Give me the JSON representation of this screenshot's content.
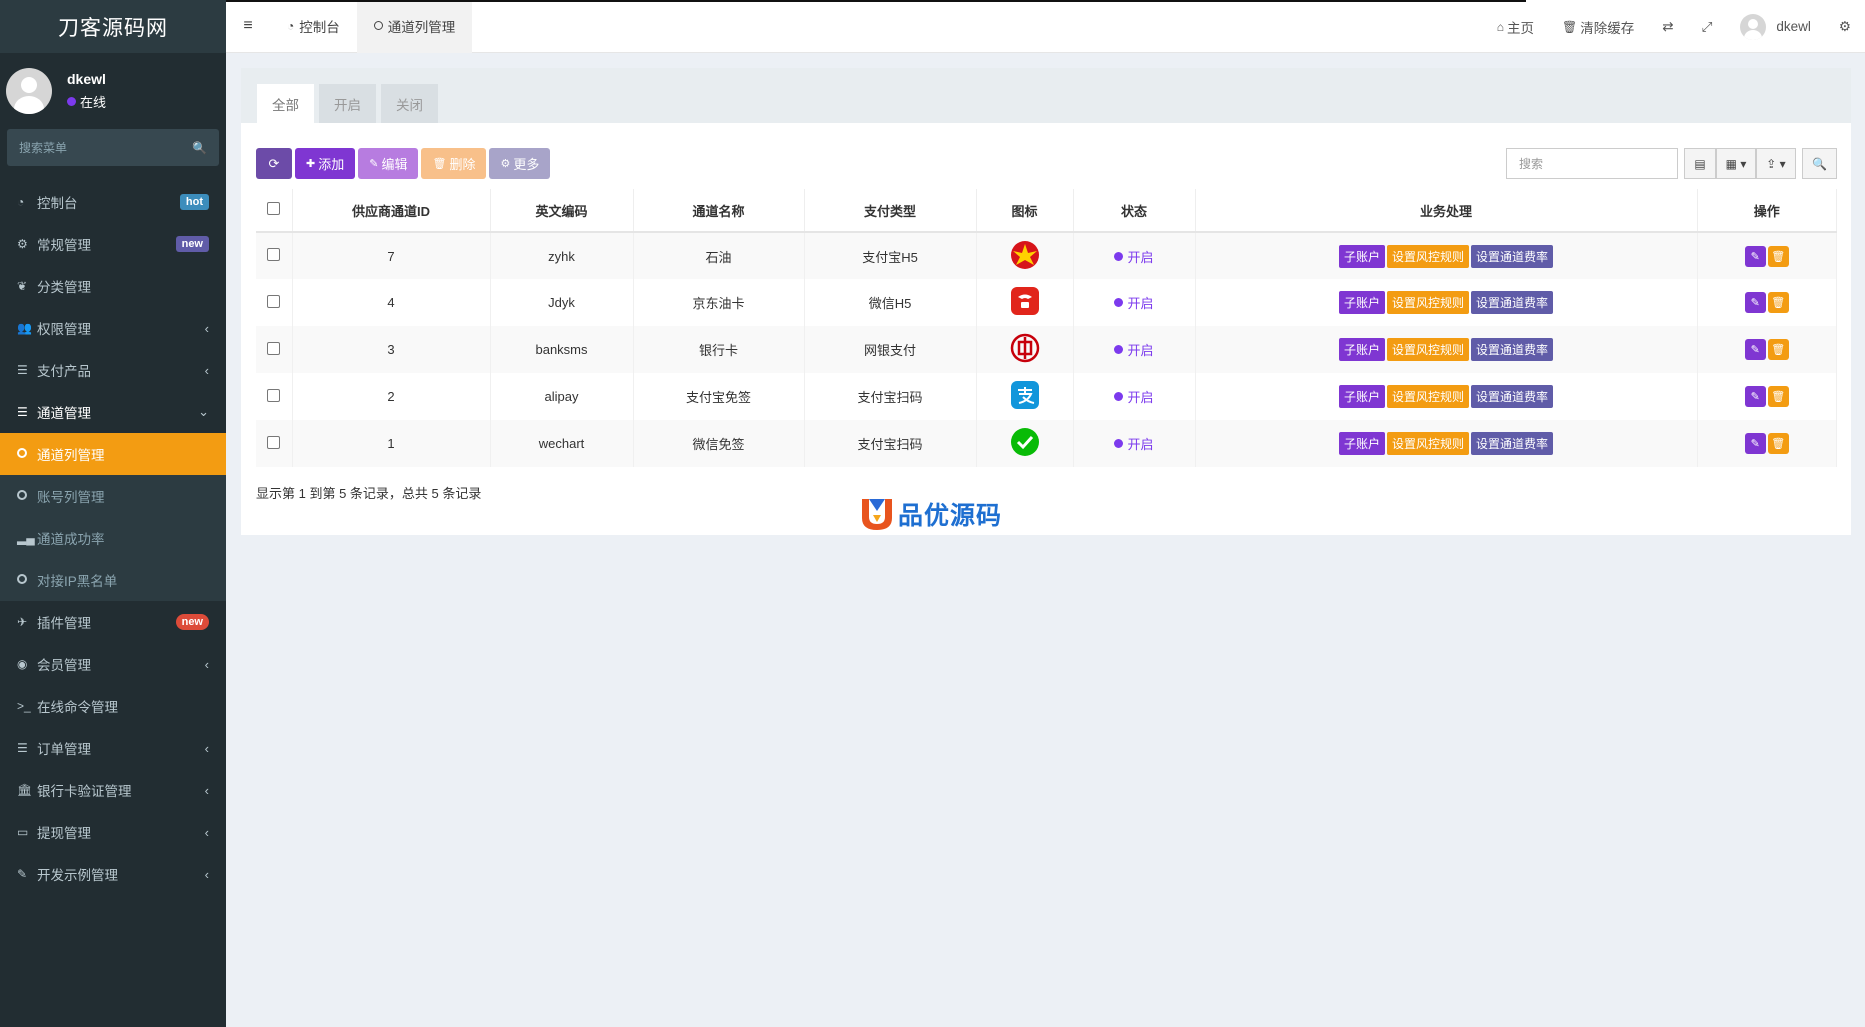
{
  "brand": "刀客源码网",
  "user": {
    "name": "dkewl",
    "status": "在线"
  },
  "search": {
    "placeholder": "搜索菜单"
  },
  "menu": [
    {
      "label": "控制台",
      "icon": "dashboard-icon",
      "badge": "hot"
    },
    {
      "label": "常规管理",
      "icon": "cogs-icon",
      "badge": "new"
    },
    {
      "label": "分类管理",
      "icon": "leaf-icon"
    },
    {
      "label": "权限管理",
      "icon": "users-icon",
      "chevron": "‹"
    },
    {
      "label": "支付产品",
      "icon": "list-icon",
      "chevron": "‹"
    },
    {
      "label": "通道管理",
      "icon": "list-icon",
      "chevron": "⌄"
    }
  ],
  "submenu": [
    {
      "label": "通道列管理",
      "icon": "circle-icon"
    },
    {
      "label": "账号列管理",
      "icon": "circle-icon"
    },
    {
      "label": "通道成功率",
      "icon": "signal-icon"
    },
    {
      "label": "对接IP黑名单",
      "icon": "circle-icon"
    }
  ],
  "menu2": [
    {
      "label": "插件管理",
      "icon": "rocket-icon",
      "badge": "new"
    },
    {
      "label": "会员管理",
      "icon": "user-circle-icon",
      "chevron": "‹"
    },
    {
      "label": "在线命令管理",
      "icon": "terminal-icon"
    },
    {
      "label": "订单管理",
      "icon": "list-icon",
      "chevron": "‹"
    },
    {
      "label": "银行卡验证管理",
      "icon": "bank-icon",
      "chevron": "‹"
    },
    {
      "label": "提现管理",
      "icon": "visa-icon",
      "chevron": "‹"
    },
    {
      "label": "开发示例管理",
      "icon": "magic-icon",
      "chevron": "‹"
    }
  ],
  "topbar": {
    "tabs": [
      "控制台",
      "通道列管理"
    ],
    "home": "主页",
    "clear_cache": "清除缓存",
    "username": "dkewl"
  },
  "panel_tabs": [
    "全部",
    "开启",
    "关闭"
  ],
  "toolbar": {
    "add": "添加",
    "edit": "编辑",
    "delete": "删除",
    "more": "更多",
    "search_placeholder": "搜索"
  },
  "table": {
    "headers": [
      "供应商通道ID",
      "英文编码",
      "通道名称",
      "支付类型",
      "图标",
      "状态",
      "业务处理",
      "操作"
    ],
    "rows": [
      {
        "id": "7",
        "code": "zyhk",
        "name": "石油",
        "type": "支付宝H5",
        "icon": "petrochina-icon",
        "status": "开启"
      },
      {
        "id": "4",
        "code": "Jdyk",
        "name": "京东油卡",
        "type": "微信H5",
        "icon": "jd-icon",
        "status": "开启"
      },
      {
        "id": "3",
        "code": "banksms",
        "name": "银行卡",
        "type": "网银支付",
        "icon": "icbc-icon",
        "status": "开启"
      },
      {
        "id": "2",
        "code": "alipay",
        "name": "支付宝免签",
        "type": "支付宝扫码",
        "icon": "alipay-icon",
        "status": "开启"
      },
      {
        "id": "1",
        "code": "wechart",
        "name": "微信免签",
        "type": "支付宝扫码",
        "icon": "wechat-icon",
        "status": "开启"
      }
    ],
    "ops": {
      "sub": "子账户",
      "risk": "设置风控规则",
      "fee": "设置通道费率"
    }
  },
  "paging": "显示第 1 到第 5 条记录，总共 5 条记录",
  "logo_text": "品优源码",
  "colors": {
    "sidebar": "#222d32",
    "active": "#f39c12",
    "purple": "#7f36d2",
    "orange": "#f39c12",
    "indigo": "#605ca8"
  }
}
